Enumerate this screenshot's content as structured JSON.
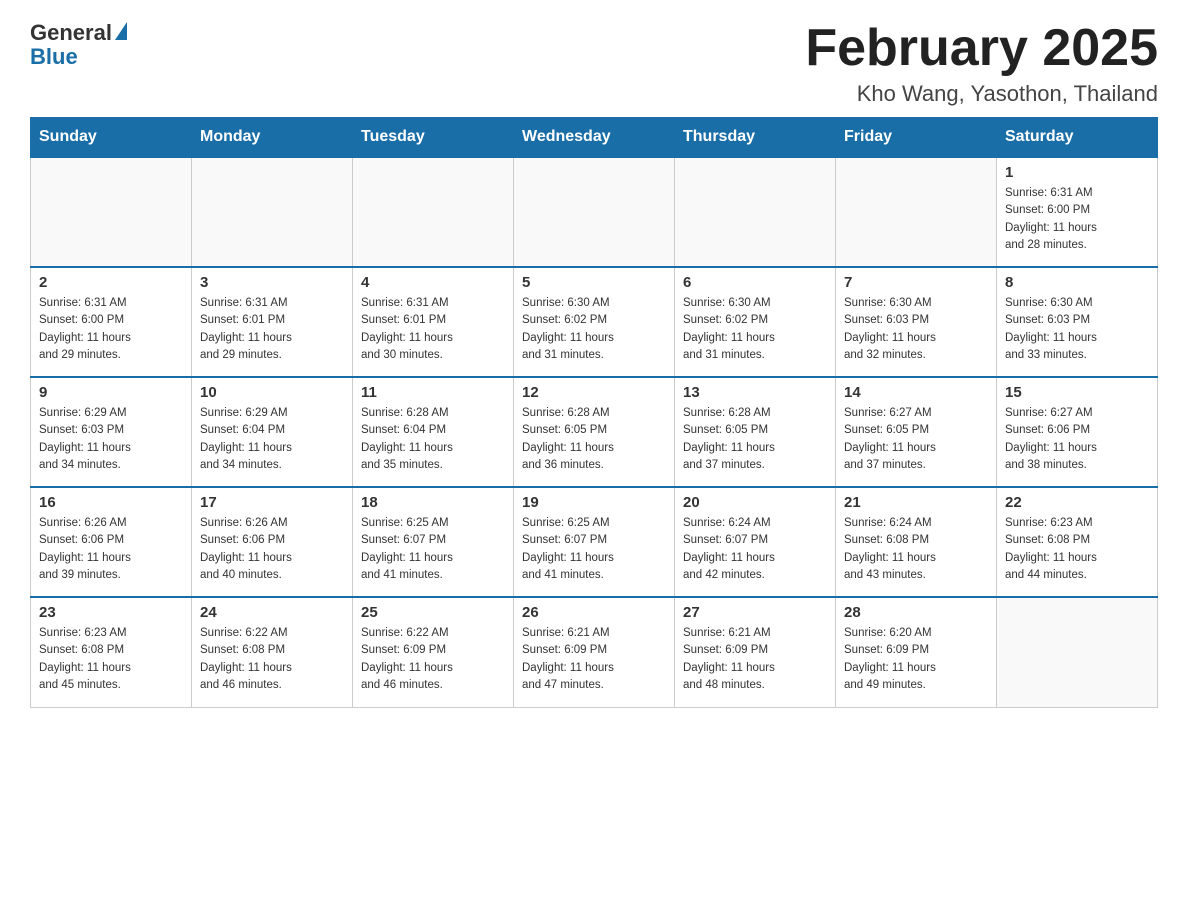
{
  "logo": {
    "general": "General",
    "blue": "Blue"
  },
  "header": {
    "month_title": "February 2025",
    "location": "Kho Wang, Yasothon, Thailand"
  },
  "weekdays": [
    "Sunday",
    "Monday",
    "Tuesday",
    "Wednesday",
    "Thursday",
    "Friday",
    "Saturday"
  ],
  "weeks": [
    [
      {
        "day": "",
        "info": ""
      },
      {
        "day": "",
        "info": ""
      },
      {
        "day": "",
        "info": ""
      },
      {
        "day": "",
        "info": ""
      },
      {
        "day": "",
        "info": ""
      },
      {
        "day": "",
        "info": ""
      },
      {
        "day": "1",
        "info": "Sunrise: 6:31 AM\nSunset: 6:00 PM\nDaylight: 11 hours\nand 28 minutes."
      }
    ],
    [
      {
        "day": "2",
        "info": "Sunrise: 6:31 AM\nSunset: 6:00 PM\nDaylight: 11 hours\nand 29 minutes."
      },
      {
        "day": "3",
        "info": "Sunrise: 6:31 AM\nSunset: 6:01 PM\nDaylight: 11 hours\nand 29 minutes."
      },
      {
        "day": "4",
        "info": "Sunrise: 6:31 AM\nSunset: 6:01 PM\nDaylight: 11 hours\nand 30 minutes."
      },
      {
        "day": "5",
        "info": "Sunrise: 6:30 AM\nSunset: 6:02 PM\nDaylight: 11 hours\nand 31 minutes."
      },
      {
        "day": "6",
        "info": "Sunrise: 6:30 AM\nSunset: 6:02 PM\nDaylight: 11 hours\nand 31 minutes."
      },
      {
        "day": "7",
        "info": "Sunrise: 6:30 AM\nSunset: 6:03 PM\nDaylight: 11 hours\nand 32 minutes."
      },
      {
        "day": "8",
        "info": "Sunrise: 6:30 AM\nSunset: 6:03 PM\nDaylight: 11 hours\nand 33 minutes."
      }
    ],
    [
      {
        "day": "9",
        "info": "Sunrise: 6:29 AM\nSunset: 6:03 PM\nDaylight: 11 hours\nand 34 minutes."
      },
      {
        "day": "10",
        "info": "Sunrise: 6:29 AM\nSunset: 6:04 PM\nDaylight: 11 hours\nand 34 minutes."
      },
      {
        "day": "11",
        "info": "Sunrise: 6:28 AM\nSunset: 6:04 PM\nDaylight: 11 hours\nand 35 minutes."
      },
      {
        "day": "12",
        "info": "Sunrise: 6:28 AM\nSunset: 6:05 PM\nDaylight: 11 hours\nand 36 minutes."
      },
      {
        "day": "13",
        "info": "Sunrise: 6:28 AM\nSunset: 6:05 PM\nDaylight: 11 hours\nand 37 minutes."
      },
      {
        "day": "14",
        "info": "Sunrise: 6:27 AM\nSunset: 6:05 PM\nDaylight: 11 hours\nand 37 minutes."
      },
      {
        "day": "15",
        "info": "Sunrise: 6:27 AM\nSunset: 6:06 PM\nDaylight: 11 hours\nand 38 minutes."
      }
    ],
    [
      {
        "day": "16",
        "info": "Sunrise: 6:26 AM\nSunset: 6:06 PM\nDaylight: 11 hours\nand 39 minutes."
      },
      {
        "day": "17",
        "info": "Sunrise: 6:26 AM\nSunset: 6:06 PM\nDaylight: 11 hours\nand 40 minutes."
      },
      {
        "day": "18",
        "info": "Sunrise: 6:25 AM\nSunset: 6:07 PM\nDaylight: 11 hours\nand 41 minutes."
      },
      {
        "day": "19",
        "info": "Sunrise: 6:25 AM\nSunset: 6:07 PM\nDaylight: 11 hours\nand 41 minutes."
      },
      {
        "day": "20",
        "info": "Sunrise: 6:24 AM\nSunset: 6:07 PM\nDaylight: 11 hours\nand 42 minutes."
      },
      {
        "day": "21",
        "info": "Sunrise: 6:24 AM\nSunset: 6:08 PM\nDaylight: 11 hours\nand 43 minutes."
      },
      {
        "day": "22",
        "info": "Sunrise: 6:23 AM\nSunset: 6:08 PM\nDaylight: 11 hours\nand 44 minutes."
      }
    ],
    [
      {
        "day": "23",
        "info": "Sunrise: 6:23 AM\nSunset: 6:08 PM\nDaylight: 11 hours\nand 45 minutes."
      },
      {
        "day": "24",
        "info": "Sunrise: 6:22 AM\nSunset: 6:08 PM\nDaylight: 11 hours\nand 46 minutes."
      },
      {
        "day": "25",
        "info": "Sunrise: 6:22 AM\nSunset: 6:09 PM\nDaylight: 11 hours\nand 46 minutes."
      },
      {
        "day": "26",
        "info": "Sunrise: 6:21 AM\nSunset: 6:09 PM\nDaylight: 11 hours\nand 47 minutes."
      },
      {
        "day": "27",
        "info": "Sunrise: 6:21 AM\nSunset: 6:09 PM\nDaylight: 11 hours\nand 48 minutes."
      },
      {
        "day": "28",
        "info": "Sunrise: 6:20 AM\nSunset: 6:09 PM\nDaylight: 11 hours\nand 49 minutes."
      },
      {
        "day": "",
        "info": ""
      }
    ]
  ]
}
